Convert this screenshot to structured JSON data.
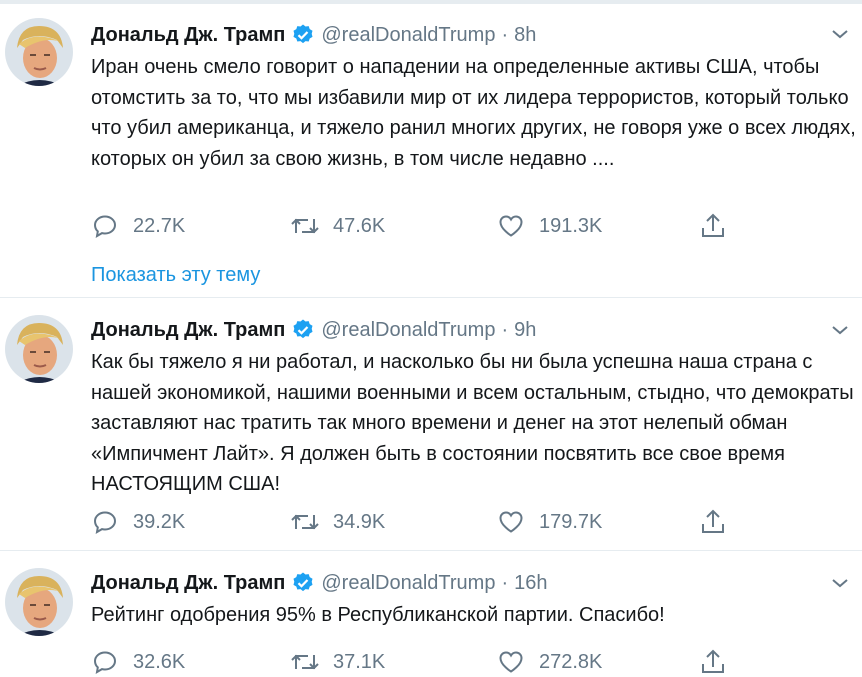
{
  "colors": {
    "link": "#1b95e0",
    "muted": "#657786",
    "verified": "#1da1f2",
    "divider": "#e6ecf0"
  },
  "icons": {
    "reply": "reply-icon",
    "retweet": "retweet-icon",
    "like": "heart-icon",
    "share": "share-icon",
    "verified": "verified-badge-icon",
    "menu": "chevron-down-icon"
  },
  "tweets": [
    {
      "name": "Дональд Дж. Трамп",
      "handle": "@realDonaldTrump",
      "separator": "·",
      "time": "8h",
      "text": "Иран очень смело говорит о нападении на определенные активы США, чтобы отомстить за то, что мы избавили мир от их лидера террористов, который только что убил американца, и тяжело ранил многих других, не говоря уже о всех людях, которых он убил за свою жизнь, в том числе недавно ....",
      "replies": "22.7K",
      "retweets": "47.6K",
      "likes": "191.3K",
      "thread_link": "Показать эту тему"
    },
    {
      "name": "Дональд Дж. Трамп",
      "handle": "@realDonaldTrump",
      "separator": "·",
      "time": "9h",
      "text": "Как бы тяжело я ни работал, и насколько бы ни была успешна наша страна с нашей экономикой, нашими военными и всем остальным, стыдно, что демократы заставляют нас тратить так много времени и денег на этот нелепый обман «Импичмент Лайт». Я должен быть в состоянии посвятить все свое время НАСТОЯЩИМ США!",
      "replies": "39.2K",
      "retweets": "34.9K",
      "likes": "179.7K"
    },
    {
      "name": "Дональд Дж. Трамп",
      "handle": "@realDonaldTrump",
      "separator": "·",
      "time": "16h",
      "text": "Рейтинг одобрения 95% в Республиканской партии. Спасибо!",
      "replies": "32.6K",
      "retweets": "37.1K",
      "likes": "272.8K"
    }
  ]
}
